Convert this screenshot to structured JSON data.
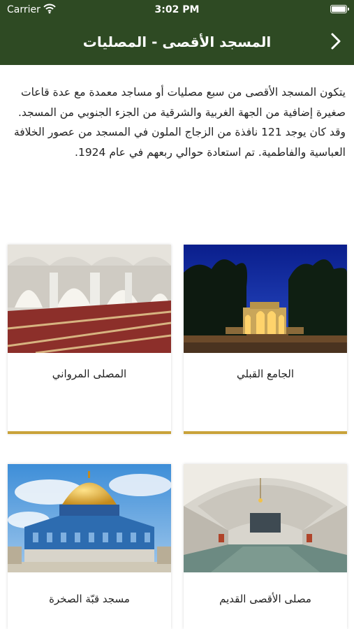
{
  "status_bar": {
    "carrier": "Carrier",
    "time": "3:02 PM",
    "wifi_icon": "wifi-icon",
    "battery_icon": "battery-icon"
  },
  "nav": {
    "title": "المسجد الأقصى - المصليات",
    "back_icon": "chevron-right-icon"
  },
  "description": "يتكون المسجد الأقصى من سبع مصليات أو مساجد معمدة مع عدة قاعات صغيرة إضافية من الجهة الغربية والشرقية من الجزء الجنوبي من المسجد. وقد كان يوجد 121 نافذة من الزجاج الملون في المسجد من عصور الخلافة العباسية والفاطمية. تم استعادة حوالي ربعهم في عام 1924.",
  "cards": [
    {
      "label": "الجامع القبلي"
    },
    {
      "label": "المصلى المرواني"
    },
    {
      "label": "مصلى الأقصى القديم"
    },
    {
      "label": "مسجد قبّة الصخرة"
    }
  ],
  "colors": {
    "header": "#2e4a23",
    "accent": "#c9a23a"
  }
}
